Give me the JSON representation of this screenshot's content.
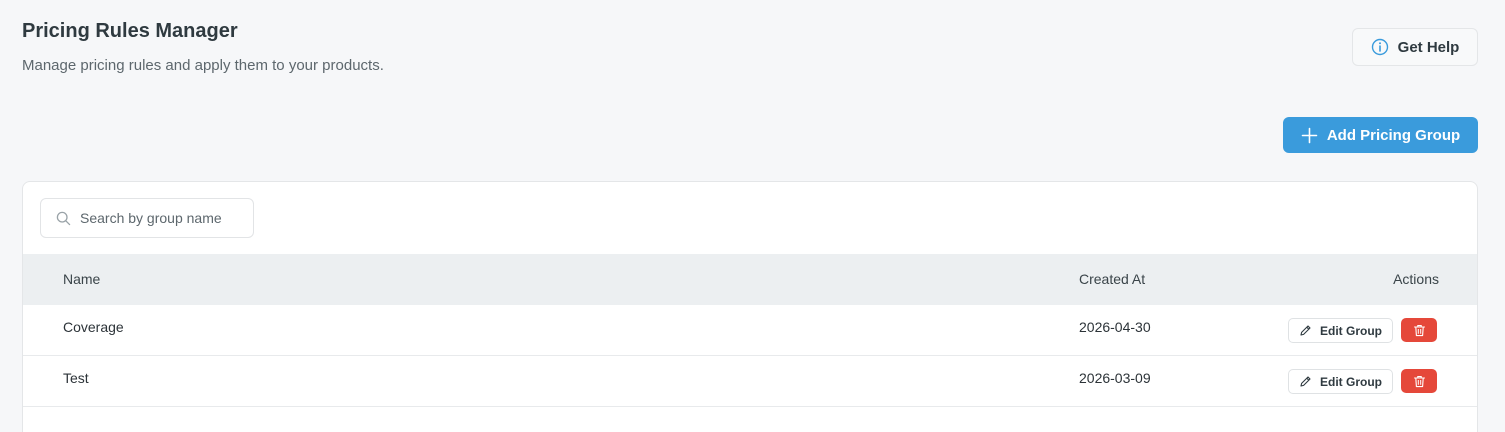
{
  "header": {
    "title": "Pricing Rules Manager",
    "subtitle": "Manage pricing rules and apply them to your products.",
    "help_label": "Get Help",
    "help_icon": "info-circle-icon"
  },
  "toolbar": {
    "add_label": "Add Pricing Group",
    "add_icon": "plus-icon"
  },
  "search": {
    "placeholder": "Search by group name",
    "value": "",
    "icon": "search-icon"
  },
  "table": {
    "columns": [
      "Name",
      "Created At",
      "Actions"
    ],
    "rows": [
      {
        "name": "Coverage",
        "created_at": "2026-04-30",
        "edit_label": "Edit Group"
      },
      {
        "name": "Test",
        "created_at": "2026-03-09",
        "edit_label": "Edit Group"
      }
    ]
  },
  "colors": {
    "primary": "#3a9bdc",
    "danger": "#e5483a",
    "background": "#f6f7f9",
    "table_header": "#eceff1"
  }
}
